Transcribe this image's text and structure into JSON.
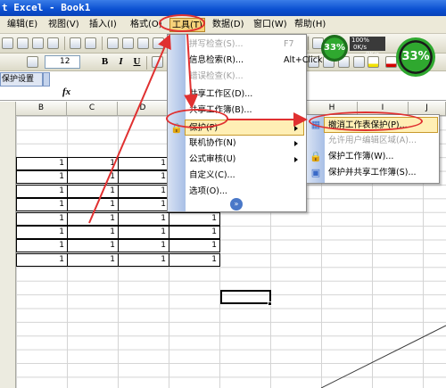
{
  "window": {
    "title": "t Excel - Book1"
  },
  "menubar": {
    "items": [
      {
        "label": "编辑(E)"
      },
      {
        "label": "视图(V)"
      },
      {
        "label": "插入(I)"
      },
      {
        "label": "格式(O)"
      },
      {
        "label": "工具(T)"
      },
      {
        "label": "数据(D)"
      },
      {
        "label": "窗口(W)"
      },
      {
        "label": "帮助(H)"
      }
    ]
  },
  "toolbar": {
    "font_size": "12",
    "bold": "B",
    "italic": "I",
    "underline": "U",
    "gauge_small": "33%",
    "gauge_large": "33%",
    "network_up": "100%",
    "speed_a": "0K/s",
    "speed_b": "0K/s"
  },
  "task_pane": {
    "label": "保护设置"
  },
  "formula_bar": {
    "fx": "fx"
  },
  "columns": [
    "B",
    "C",
    "D",
    "H",
    "I",
    "J"
  ],
  "cells": {
    "value": "1"
  },
  "tools_menu": {
    "items": [
      {
        "label": "拼写检查(S)...",
        "shortcut": "F7",
        "disabled": true
      },
      {
        "label": "信息检索(R)...",
        "shortcut": "Alt+Click",
        "disabled": false
      },
      {
        "label": "错误检查(K)...",
        "shortcut": "",
        "disabled": true
      },
      {
        "label": "共享工作区(D)...",
        "shortcut": "",
        "disabled": false
      },
      {
        "label": "共享工作簿(B)...",
        "shortcut": "",
        "disabled": false
      },
      {
        "label": "保护(P)",
        "shortcut": "",
        "disabled": false
      },
      {
        "label": "联机协作(N)",
        "shortcut": "",
        "disabled": false
      },
      {
        "label": "公式审核(U)",
        "shortcut": "",
        "disabled": false
      },
      {
        "label": "自定义(C)...",
        "shortcut": "",
        "disabled": false
      },
      {
        "label": "选项(O)...",
        "shortcut": "",
        "disabled": false
      }
    ]
  },
  "protection_submenu": {
    "items": [
      {
        "label": "撤消工作表保护(P)...",
        "disabled": false
      },
      {
        "label": "允许用户编辑区域(A)...",
        "disabled": true
      },
      {
        "label": "保护工作簿(W)...",
        "disabled": false
      },
      {
        "label": "保护并共享工作簿(S)...",
        "disabled": false
      }
    ]
  },
  "colors": {
    "title_bar": "#0a4fd0",
    "annotation": "#e03030",
    "menu_highlight": "#ffefb5",
    "gauge_green": "#2fa82f"
  }
}
